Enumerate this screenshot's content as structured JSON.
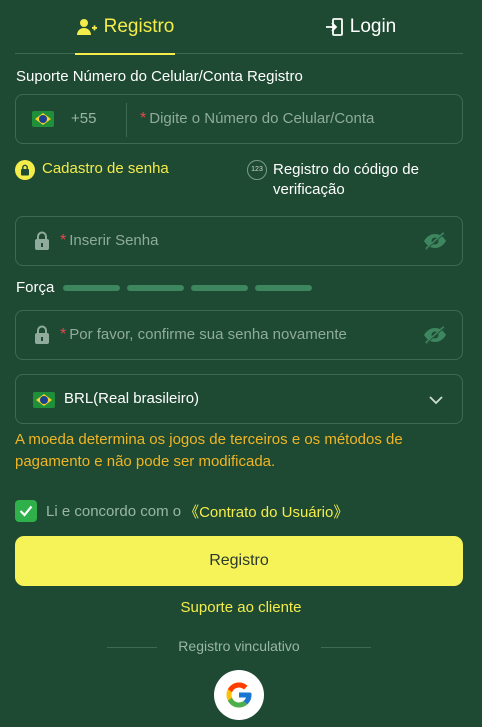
{
  "tabs": {
    "register_label": "Registro",
    "login_label": "Login"
  },
  "form": {
    "section_title": "Suporte Número do Celular/Conta Registro",
    "phone": {
      "prefix": "+55",
      "required_mark": "*",
      "placeholder": "Digite o Número do Celular/Conta"
    },
    "options": {
      "password_label": "Cadastro de senha",
      "code_badge": "123",
      "code_label": "Registro do código de verificação"
    },
    "password": {
      "required_mark": "*",
      "placeholder": "Inserir Senha"
    },
    "strength_label": "Força",
    "confirm": {
      "required_mark": "*",
      "placeholder": "Por favor, confirme sua senha novamente"
    },
    "currency": {
      "selected": "BRL(Real brasileiro)"
    },
    "currency_note": "A moeda determina os jogos de terceiros e os métodos de pagamento e não pode ser modificada.",
    "agreement": {
      "checked": true,
      "text": "Li e concordo com o",
      "link": "《Contrato do Usuário》"
    },
    "submit_label": "Registro"
  },
  "footer": {
    "support_label": "Suporte ao cliente",
    "bind_label": "Registro vinculativo"
  },
  "colors": {
    "background": "#1e4a33",
    "accent": "#f4ec4a",
    "warning": "#f0b524",
    "checkbox": "#2fb04a"
  },
  "icons": [
    "add-user-icon",
    "login-icon",
    "brazil-flag-icon",
    "lock-icon",
    "eye-off-icon",
    "chevron-down-icon",
    "check-icon",
    "google-icon"
  ]
}
